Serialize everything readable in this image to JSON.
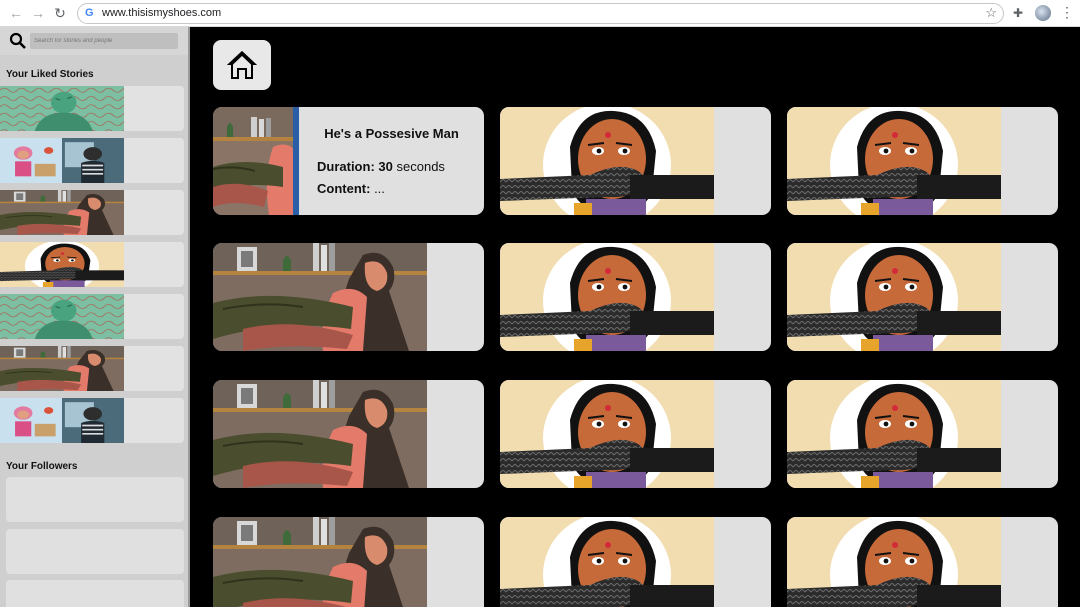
{
  "browser": {
    "url": "www.thisismyshoes.com",
    "google_icon": "G"
  },
  "sidebar": {
    "search_placeholder": "Search for stories and people",
    "liked_title": "Your Liked Stories",
    "liked_items": [
      {
        "art": "green-figure"
      },
      {
        "art": "girl-and-man"
      },
      {
        "art": "room-hands"
      },
      {
        "art": "face-hand"
      },
      {
        "art": "green-figure"
      },
      {
        "art": "room-hands"
      },
      {
        "art": "girl-and-man"
      }
    ],
    "followers_title": "Your Followers"
  },
  "main": {
    "featured": {
      "title": "He's a Possesive Man",
      "duration_label": "Duration:",
      "duration_value": "30",
      "duration_unit": "seconds",
      "content_label": "Content:",
      "content_value": "..."
    }
  },
  "colors": {
    "background": "#000000",
    "sidebar": "#cfcfcf",
    "card": "#e0e0e0"
  }
}
